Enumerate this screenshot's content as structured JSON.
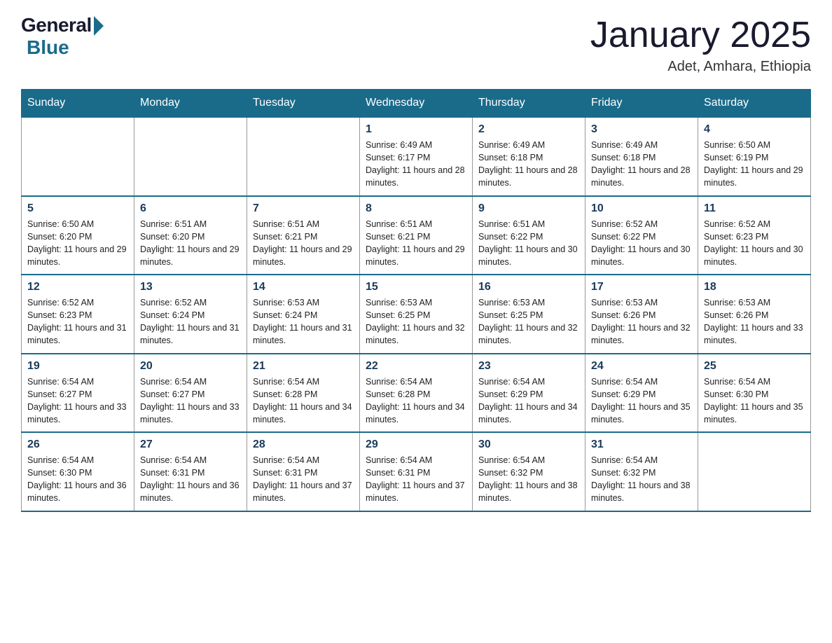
{
  "header": {
    "logo_general": "General",
    "logo_blue": "Blue",
    "month_title": "January 2025",
    "subtitle": "Adet, Amhara, Ethiopia"
  },
  "weekdays": [
    "Sunday",
    "Monday",
    "Tuesday",
    "Wednesday",
    "Thursday",
    "Friday",
    "Saturday"
  ],
  "weeks": [
    [
      {
        "day": "",
        "info": ""
      },
      {
        "day": "",
        "info": ""
      },
      {
        "day": "",
        "info": ""
      },
      {
        "day": "1",
        "info": "Sunrise: 6:49 AM\nSunset: 6:17 PM\nDaylight: 11 hours and 28 minutes."
      },
      {
        "day": "2",
        "info": "Sunrise: 6:49 AM\nSunset: 6:18 PM\nDaylight: 11 hours and 28 minutes."
      },
      {
        "day": "3",
        "info": "Sunrise: 6:49 AM\nSunset: 6:18 PM\nDaylight: 11 hours and 28 minutes."
      },
      {
        "day": "4",
        "info": "Sunrise: 6:50 AM\nSunset: 6:19 PM\nDaylight: 11 hours and 29 minutes."
      }
    ],
    [
      {
        "day": "5",
        "info": "Sunrise: 6:50 AM\nSunset: 6:20 PM\nDaylight: 11 hours and 29 minutes."
      },
      {
        "day": "6",
        "info": "Sunrise: 6:51 AM\nSunset: 6:20 PM\nDaylight: 11 hours and 29 minutes."
      },
      {
        "day": "7",
        "info": "Sunrise: 6:51 AM\nSunset: 6:21 PM\nDaylight: 11 hours and 29 minutes."
      },
      {
        "day": "8",
        "info": "Sunrise: 6:51 AM\nSunset: 6:21 PM\nDaylight: 11 hours and 29 minutes."
      },
      {
        "day": "9",
        "info": "Sunrise: 6:51 AM\nSunset: 6:22 PM\nDaylight: 11 hours and 30 minutes."
      },
      {
        "day": "10",
        "info": "Sunrise: 6:52 AM\nSunset: 6:22 PM\nDaylight: 11 hours and 30 minutes."
      },
      {
        "day": "11",
        "info": "Sunrise: 6:52 AM\nSunset: 6:23 PM\nDaylight: 11 hours and 30 minutes."
      }
    ],
    [
      {
        "day": "12",
        "info": "Sunrise: 6:52 AM\nSunset: 6:23 PM\nDaylight: 11 hours and 31 minutes."
      },
      {
        "day": "13",
        "info": "Sunrise: 6:52 AM\nSunset: 6:24 PM\nDaylight: 11 hours and 31 minutes."
      },
      {
        "day": "14",
        "info": "Sunrise: 6:53 AM\nSunset: 6:24 PM\nDaylight: 11 hours and 31 minutes."
      },
      {
        "day": "15",
        "info": "Sunrise: 6:53 AM\nSunset: 6:25 PM\nDaylight: 11 hours and 32 minutes."
      },
      {
        "day": "16",
        "info": "Sunrise: 6:53 AM\nSunset: 6:25 PM\nDaylight: 11 hours and 32 minutes."
      },
      {
        "day": "17",
        "info": "Sunrise: 6:53 AM\nSunset: 6:26 PM\nDaylight: 11 hours and 32 minutes."
      },
      {
        "day": "18",
        "info": "Sunrise: 6:53 AM\nSunset: 6:26 PM\nDaylight: 11 hours and 33 minutes."
      }
    ],
    [
      {
        "day": "19",
        "info": "Sunrise: 6:54 AM\nSunset: 6:27 PM\nDaylight: 11 hours and 33 minutes."
      },
      {
        "day": "20",
        "info": "Sunrise: 6:54 AM\nSunset: 6:27 PM\nDaylight: 11 hours and 33 minutes."
      },
      {
        "day": "21",
        "info": "Sunrise: 6:54 AM\nSunset: 6:28 PM\nDaylight: 11 hours and 34 minutes."
      },
      {
        "day": "22",
        "info": "Sunrise: 6:54 AM\nSunset: 6:28 PM\nDaylight: 11 hours and 34 minutes."
      },
      {
        "day": "23",
        "info": "Sunrise: 6:54 AM\nSunset: 6:29 PM\nDaylight: 11 hours and 34 minutes."
      },
      {
        "day": "24",
        "info": "Sunrise: 6:54 AM\nSunset: 6:29 PM\nDaylight: 11 hours and 35 minutes."
      },
      {
        "day": "25",
        "info": "Sunrise: 6:54 AM\nSunset: 6:30 PM\nDaylight: 11 hours and 35 minutes."
      }
    ],
    [
      {
        "day": "26",
        "info": "Sunrise: 6:54 AM\nSunset: 6:30 PM\nDaylight: 11 hours and 36 minutes."
      },
      {
        "day": "27",
        "info": "Sunrise: 6:54 AM\nSunset: 6:31 PM\nDaylight: 11 hours and 36 minutes."
      },
      {
        "day": "28",
        "info": "Sunrise: 6:54 AM\nSunset: 6:31 PM\nDaylight: 11 hours and 37 minutes."
      },
      {
        "day": "29",
        "info": "Sunrise: 6:54 AM\nSunset: 6:31 PM\nDaylight: 11 hours and 37 minutes."
      },
      {
        "day": "30",
        "info": "Sunrise: 6:54 AM\nSunset: 6:32 PM\nDaylight: 11 hours and 38 minutes."
      },
      {
        "day": "31",
        "info": "Sunrise: 6:54 AM\nSunset: 6:32 PM\nDaylight: 11 hours and 38 minutes."
      },
      {
        "day": "",
        "info": ""
      }
    ]
  ]
}
